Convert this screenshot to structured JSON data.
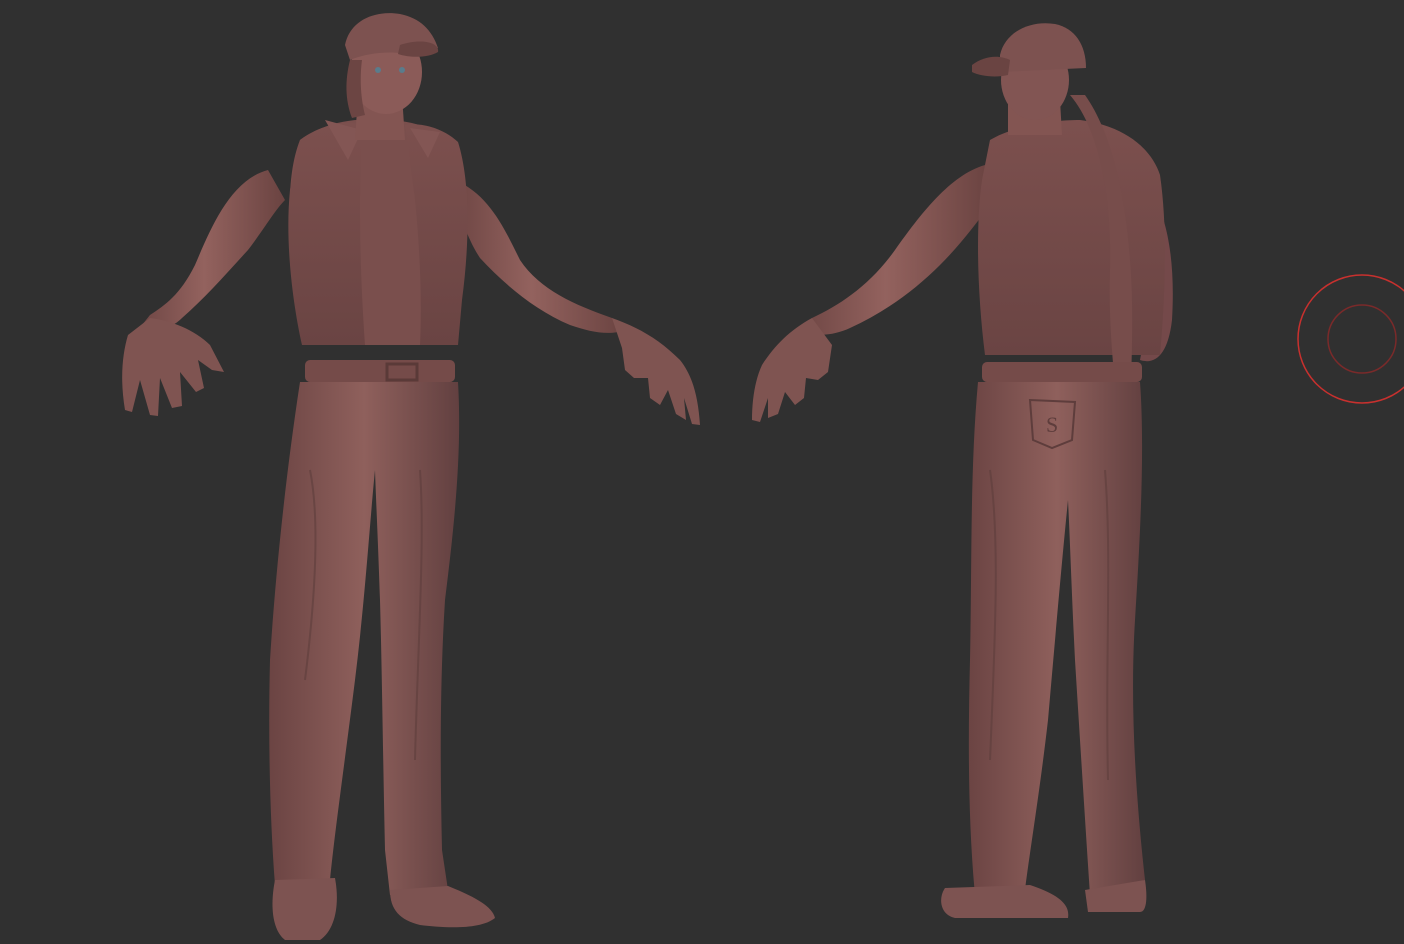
{
  "viewport": {
    "background": "#303030",
    "material_color": "#8a5a58",
    "material_shadow": "#5c3a3a",
    "material_highlight": "#a97772"
  },
  "models": [
    {
      "name": "character-front-view",
      "view": "front"
    },
    {
      "name": "character-back-view",
      "view": "back"
    }
  ],
  "brush_cursor": {
    "icon": "brush-cursor-icon",
    "outer_color": "#c8302e",
    "inner_color": "#7a2a2a"
  }
}
